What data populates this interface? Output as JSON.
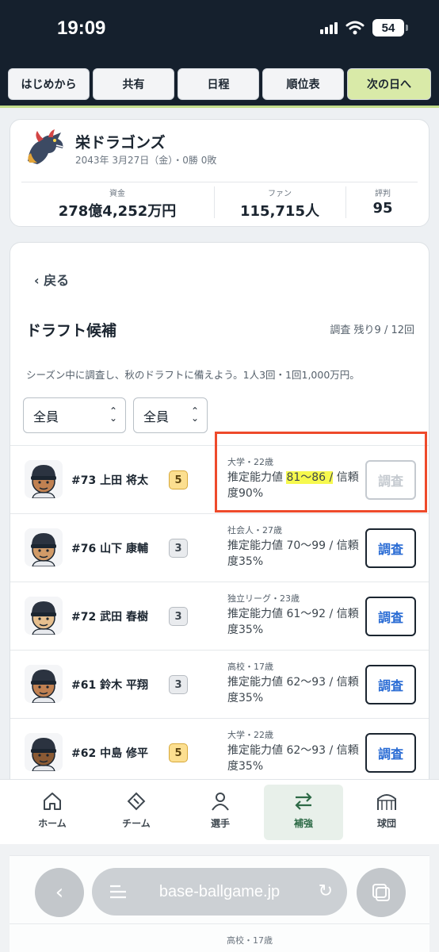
{
  "status": {
    "time": "19:09",
    "battery": "54"
  },
  "nav": {
    "start": "はじめから",
    "share": "共有",
    "schedule": "日程",
    "standings": "順位表",
    "next_day": "次の日へ"
  },
  "team": {
    "name": "栄ドラゴンズ",
    "date_record": "2043年 3月27日（金）・0勝 0敗",
    "funds_label": "資金",
    "funds_value": "278億4,252万円",
    "fans_label": "ファン",
    "fans_value": "115,715人",
    "rep_label": "評判",
    "rep_value": "95"
  },
  "draft": {
    "back": "‹ 戻る",
    "title": "ドラフト候補",
    "remaining": "調査 残り9 / 12回",
    "description": "シーズン中に調査し、秋のドラフトに備えよう。1人3回・1回1,000万円。",
    "filter1": "全員",
    "filter2": "全員",
    "survey_label": "調査",
    "players": [
      {
        "num_name": "#73 上田 将太",
        "rank": "5",
        "meta": "大学・22歳",
        "est_prefix": "推定能力値 ",
        "est_range": "81〜86 /",
        "est_suffix": " 信頼度90%"
      },
      {
        "num_name": "#76 山下 康輔",
        "rank": "3",
        "meta": "社会人・27歳",
        "est_text": "推定能力値 70〜99 / 信頼度35%"
      },
      {
        "num_name": "#72 武田 春樹",
        "rank": "3",
        "meta": "独立リーグ・23歳",
        "est_text": "推定能力値 61〜92 / 信頼度35%"
      },
      {
        "num_name": "#61 鈴木 平翔",
        "rank": "3",
        "meta": "高校・17歳",
        "est_text": "推定能力値 62〜93 / 信頼度35%"
      },
      {
        "num_name": "#62 中島 修平",
        "rank": "5",
        "meta": "大学・22歳",
        "est_text": "推定能力値 62〜93 / 信頼度35%"
      }
    ]
  },
  "tabs": {
    "home": "ホーム",
    "team": "チーム",
    "players": "選手",
    "reinforce": "補強",
    "club": "球団"
  },
  "browser": {
    "url": "base-ballgame.jp",
    "partial_meta": "高校・17歳"
  }
}
